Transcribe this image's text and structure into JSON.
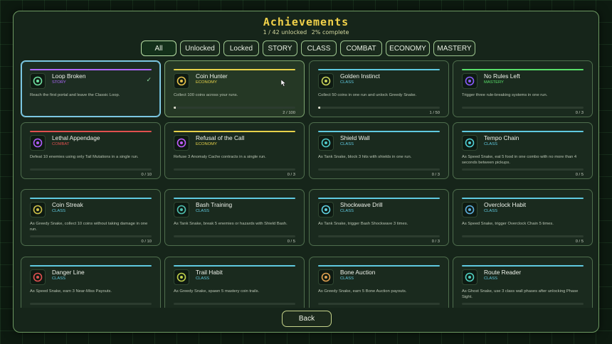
{
  "header": {
    "title": "Achievements",
    "unlocked": "1 / 42 unlocked",
    "complete": "2% complete"
  },
  "filters": [
    {
      "label": "All",
      "active": true
    },
    {
      "label": "Unlocked"
    },
    {
      "label": "Locked"
    },
    {
      "label": "STORY"
    },
    {
      "label": "CLASS"
    },
    {
      "label": "COMBAT"
    },
    {
      "label": "ECONOMY"
    },
    {
      "label": "MASTERY"
    }
  ],
  "colors": {
    "story": "#b069ff",
    "economy": "#e7d24a",
    "class": "#5fc9e0",
    "mastery": "#59e06a",
    "combat": "#e0504f"
  },
  "achievements": [
    {
      "name": "Loop Broken",
      "category": "STORY",
      "desc": "Reach the first portal and leave the Classic Loop.",
      "progress": "",
      "fraction": 1,
      "unlocked": true,
      "icon": "portal-icon"
    },
    {
      "name": "Coin Hunter",
      "category": "ECONOMY",
      "desc": "Collect 100 coins across your runs.",
      "progress": "2 / 100",
      "fraction": 0.02,
      "icon": "coin-icon"
    },
    {
      "name": "Golden Instinct",
      "category": "CLASS",
      "desc": "Collect 50 coins in one run and unlock Greedy Snake.",
      "progress": "1 / 50",
      "fraction": 0.02,
      "icon": "snake-icon"
    },
    {
      "name": "No Rules Left",
      "category": "MASTERY",
      "desc": "Trigger three rule-breaking systems in one run.",
      "progress": "0 / 3",
      "fraction": 0,
      "icon": "chaos-icon"
    },
    {
      "name": "Lethal Appendage",
      "category": "COMBAT",
      "desc": "Defeat 10 enemies using only Tail Mutations in a single run.",
      "progress": "0 / 10",
      "fraction": 0,
      "icon": "tail-icon"
    },
    {
      "name": "Refusal of the Call",
      "category": "ECONOMY",
      "desc": "Refuse 3 Anomaly Cache contracts in a single run.",
      "progress": "0 / 3",
      "fraction": 0,
      "icon": "cache-icon"
    },
    {
      "name": "Shield Wall",
      "category": "CLASS",
      "desc": "As Tank Snake, block 3 hits with shields in one run.",
      "progress": "0 / 3",
      "fraction": 0,
      "icon": "shield-icon"
    },
    {
      "name": "Tempo Chain",
      "category": "CLASS",
      "desc": "As Speed Snake, eat 5 food in one combo with no more than 4 seconds between pickups.",
      "progress": "0 / 5",
      "fraction": 0,
      "icon": "speed-icon"
    },
    {
      "name": "Coin Streak",
      "category": "CLASS",
      "desc": "As Greedy Snake, collect 10 coins without taking damage in one run.",
      "progress": "0 / 10",
      "fraction": 0,
      "icon": "coil-icon"
    },
    {
      "name": "Bash Training",
      "category": "CLASS",
      "desc": "As Tank Snake, break 5 enemies or hazards with Shield Bash.",
      "progress": "0 / 5",
      "fraction": 0,
      "icon": "bash-icon"
    },
    {
      "name": "Shockwave Drill",
      "category": "CLASS",
      "desc": "As Tank Snake, trigger Bash Shockwave 3 times.",
      "progress": "0 / 3",
      "fraction": 0,
      "icon": "shockwave-icon"
    },
    {
      "name": "Overclock Habit",
      "category": "CLASS",
      "desc": "As Speed Snake, trigger Overclock Chain 5 times.",
      "progress": "0 / 5",
      "fraction": 0,
      "icon": "overclock-icon"
    },
    {
      "name": "Danger Line",
      "category": "CLASS",
      "desc": "As Speed Snake, earn 3 Near-Miss Payouts.",
      "progress": "",
      "fraction": 0,
      "icon": "danger-icon"
    },
    {
      "name": "Trail Habit",
      "category": "CLASS",
      "desc": "As Greedy Snake, spawn 5 mastery coin trails.",
      "progress": "",
      "fraction": 0,
      "icon": "trail-icon"
    },
    {
      "name": "Bone Auction",
      "category": "CLASS",
      "desc": "As Greedy Snake, earn 5 Bone Auction payouts.",
      "progress": "",
      "fraction": 0,
      "icon": "bone-icon"
    },
    {
      "name": "Route Reader",
      "category": "CLASS",
      "desc": "As Ghost Snake, use 3 class wall phases after unlocking Phase Sight.",
      "progress": "",
      "fraction": 0,
      "icon": "ghost-icon"
    }
  ],
  "footer": {
    "back_label": "Back"
  }
}
